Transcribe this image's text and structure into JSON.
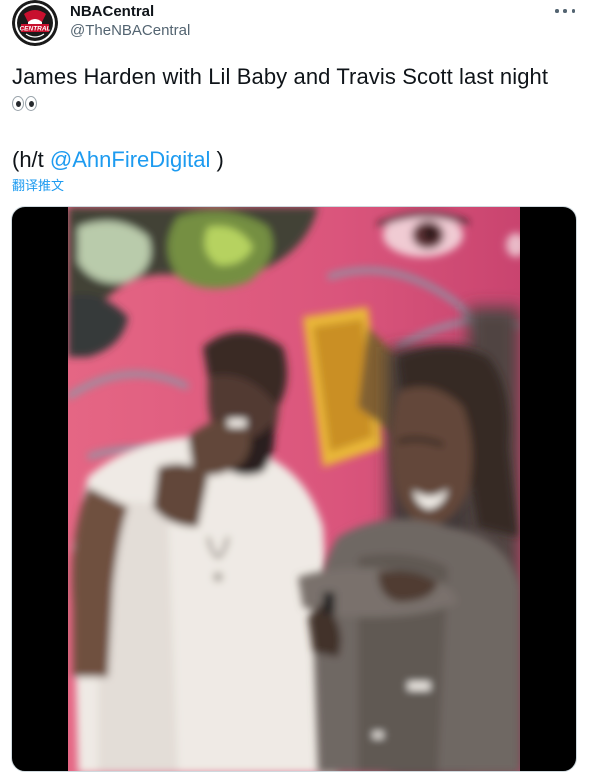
{
  "author": {
    "display_name": "NBACentral",
    "handle": "@TheNBACentral",
    "avatar_logo_text": "CENTRAL"
  },
  "tweet": {
    "text_line1": "James Harden with Lil Baby and Travis Scott last night",
    "emoji": "eyes",
    "ht_prefix": "(h/t ",
    "mention": "@AhnFireDigital",
    "ht_suffix": " )",
    "translate_label": "翻译推文"
  },
  "media": {
    "type": "video",
    "description_icon": "video-still"
  },
  "colors": {
    "link": "#1d9bf0",
    "text": "#0f1419",
    "secondary": "#536471",
    "avatar_red": "#c8102e"
  },
  "icons": {
    "more": "more-horizontal-icon",
    "eyes": "eyes-emoji-icon"
  }
}
